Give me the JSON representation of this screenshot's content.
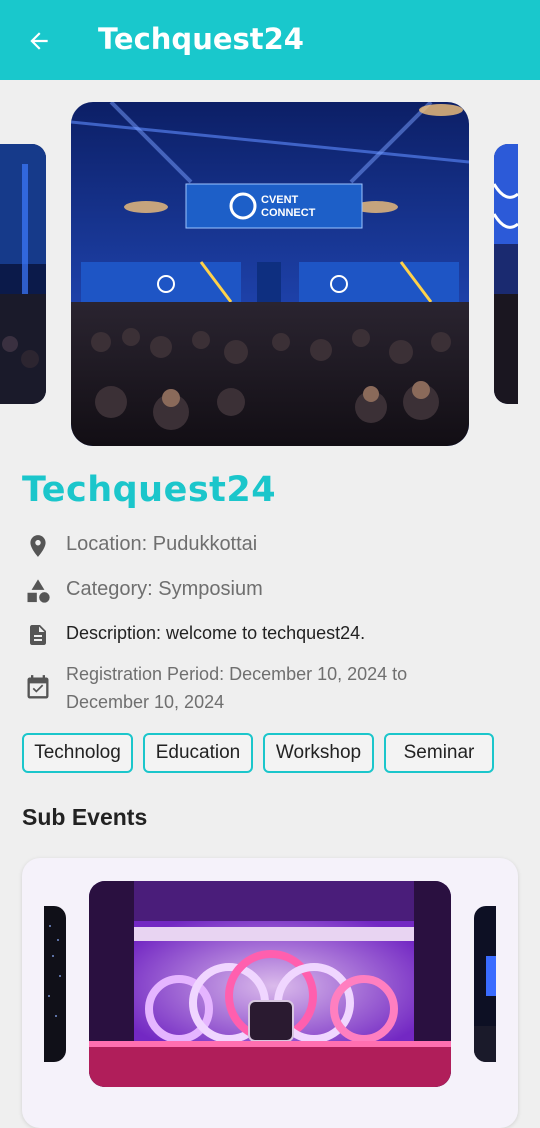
{
  "appbar": {
    "title": "Techquest24",
    "back_icon": "arrow-left-icon",
    "color": "#19c8cc"
  },
  "event": {
    "title": "Techquest24",
    "location": "Location: Pudukkottai",
    "category": "Category: Symposium",
    "description": "Description: welcome to techquest24.",
    "registration_line1": "Registration Period: December 10, 2024 to",
    "registration_line2": "December 10, 2024",
    "banner_sign": "CVENT",
    "banner_sign2": "CONNECT"
  },
  "tags": [
    "Technolog",
    "Education",
    "Workshop",
    "Seminar"
  ],
  "sub_events": {
    "title": "Sub Events"
  },
  "accent_color": "#1bc6cb"
}
